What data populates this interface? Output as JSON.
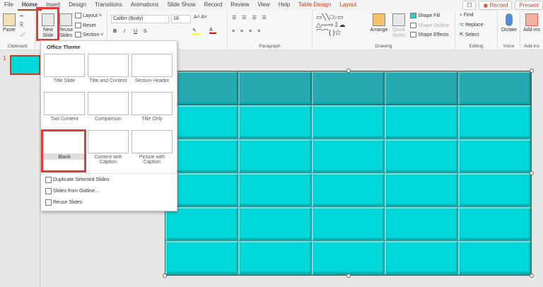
{
  "tabs": [
    "File",
    "Home",
    "Insert",
    "Design",
    "Transitions",
    "Animations",
    "Slide Show",
    "Record",
    "Review",
    "View",
    "Help",
    "Table Design",
    "Layout"
  ],
  "tabs_right": {
    "comment": "☐",
    "record": "◉ Record",
    "present": "Present"
  },
  "ribbon": {
    "clipboard": {
      "paste": "Paste",
      "label": "Clipboard"
    },
    "slides": {
      "new_slide": "New Slide",
      "reuse": "Reuse Slides",
      "layout": "Layout",
      "reset": "Reset",
      "section": "Section"
    },
    "font": {
      "name": "Calibri (Body)",
      "size": "18",
      "bold": "B",
      "italic": "I",
      "underline": "U",
      "strike": "S",
      "label": "Font"
    },
    "paragraph": {
      "label": "Paragraph"
    },
    "drawing": {
      "arrange": "Arrange",
      "quick_styles": "Quick Styles",
      "shape_fill": "Shape Fill",
      "shape_outline": "Shape Outline",
      "shape_effects": "Shape Effects",
      "label": "Drawing"
    },
    "editing": {
      "find": "Find",
      "replace": "Replace",
      "select": "Select",
      "label": "Editing"
    },
    "voice": {
      "dictate": "Dictate",
      "label": "Voice"
    },
    "addins": {
      "addins": "Add-ins",
      "label": "Add-ins"
    }
  },
  "thumbs": {
    "slide_number": "1"
  },
  "menu": {
    "title": "Office Theme",
    "layouts": [
      "Title Slide",
      "Title and Content",
      "Section Header",
      "Two Content",
      "Comparison",
      "Title Only",
      "Blank",
      "Content with Caption",
      "Picture with Caption"
    ],
    "items": [
      "Duplicate Selected Slides",
      "Slides from Outline...",
      "Reuse Slides"
    ]
  },
  "colors": {
    "accent": "#c43e1c",
    "highlight": "#e53935",
    "header_cell": "#27a9b2",
    "body_cell": "#00d9d9"
  }
}
